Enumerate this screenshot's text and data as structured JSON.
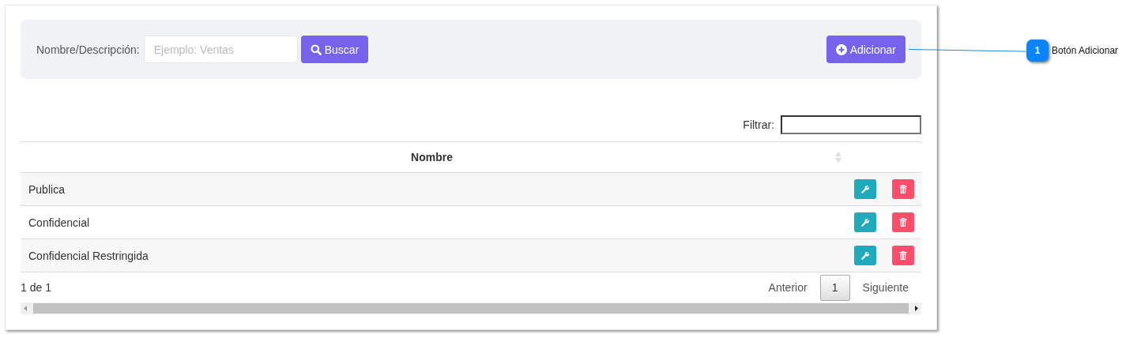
{
  "search": {
    "label": "Nombre/Descripción:",
    "placeholder": "Ejemplo: Ventas",
    "button": "Buscar"
  },
  "add_button": "Adicionar",
  "filter": {
    "label": "Filtrar:"
  },
  "table": {
    "columns": [
      "Nombre"
    ],
    "rows": [
      {
        "name": "Publica"
      },
      {
        "name": "Confidencial"
      },
      {
        "name": "Confidencial Restringida"
      }
    ]
  },
  "footer": {
    "info": "1 de 1",
    "previous": "Anterior",
    "pages": [
      {
        "label": "1",
        "selected": true
      }
    ],
    "next": "Siguiente"
  },
  "callout": {
    "number": "1",
    "text": "Botón Adicionar"
  }
}
